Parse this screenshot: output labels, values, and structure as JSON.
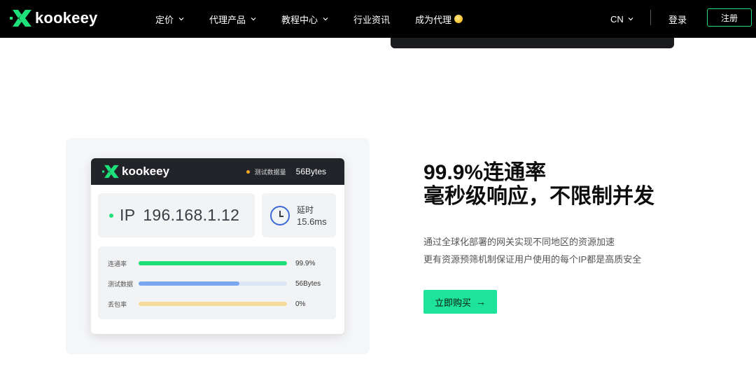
{
  "brand": {
    "name": "kookeey",
    "accent": "#1ee07a"
  },
  "nav": {
    "items": [
      {
        "label": "定价",
        "has_dropdown": true
      },
      {
        "label": "代理产品",
        "has_dropdown": true
      },
      {
        "label": "教程中心",
        "has_dropdown": true
      },
      {
        "label": "行业资讯",
        "has_dropdown": false
      },
      {
        "label": "成为代理",
        "has_dropdown": false,
        "badge_icon": "coin-icon"
      }
    ],
    "language": "CN",
    "login": "登录",
    "register": "注册"
  },
  "feature_card": {
    "logo_text": "kookeey",
    "metric_label": "测试数据量",
    "metric_value": "56Bytes",
    "ip_label": "IP",
    "ip_value": "196.168.1.12",
    "latency_label": "延时",
    "latency_value": "15.6ms",
    "stats": [
      {
        "label": "连通率",
        "value": "99.9%",
        "fill": 0.99,
        "color": "#1ee07a",
        "track": "#1ee07a"
      },
      {
        "label": "测试数据",
        "value": "56Bytes",
        "fill": 0.68,
        "color": "#7aa7f0",
        "track": "#dde6f7"
      },
      {
        "label": "丢包率",
        "value": "0%",
        "fill": 1.0,
        "color": "#f6dc9a",
        "track": "#f6dc9a"
      }
    ]
  },
  "section": {
    "headline_line1": "99.9%连通率",
    "headline_line2": "毫秒级响应，不限制并发",
    "desc_line1": "通过全球化部署的网关实现不同地区的资源加速",
    "desc_line2": "更有资源预筛机制保证用户使用的每个IP都是高质安全",
    "cta_label": "立即购买",
    "cta_arrow": "→"
  }
}
